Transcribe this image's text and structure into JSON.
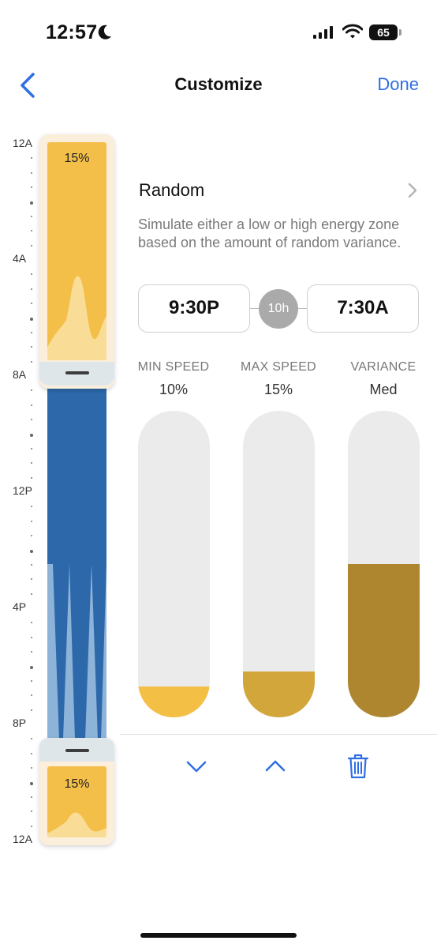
{
  "status_bar": {
    "time": "12:57",
    "battery": "65"
  },
  "nav": {
    "title": "Customize",
    "done_label": "Done"
  },
  "ruler": {
    "labels": [
      "12A",
      "4A",
      "8A",
      "12P",
      "4P",
      "8P",
      "12A"
    ]
  },
  "timeline": {
    "top_block": {
      "percent": "15%"
    },
    "bottom_block": {
      "percent": "15%"
    }
  },
  "mode": {
    "name": "Random",
    "description": "Simulate either a low or high energy zone based on the amount of random variance."
  },
  "schedule": {
    "start": "9:30P",
    "duration": "10h",
    "end": "7:30A"
  },
  "columns": [
    {
      "header": "MIN SPEED",
      "value": "10%",
      "level": 0.1,
      "color": "#f4bf45"
    },
    {
      "header": "MAX SPEED",
      "value": "15%",
      "level": 0.15,
      "color": "#d3a63b"
    },
    {
      "header": "VARIANCE",
      "value": "Med",
      "level": 0.5,
      "color": "#ae8630"
    }
  ],
  "actions": [
    "chevron-down-icon",
    "chevron-up-icon",
    "trash-icon"
  ],
  "colors": {
    "accent": "#2f6fe4",
    "night_blue": "#2d69aa",
    "sun_yellow": "#f4bf49"
  }
}
